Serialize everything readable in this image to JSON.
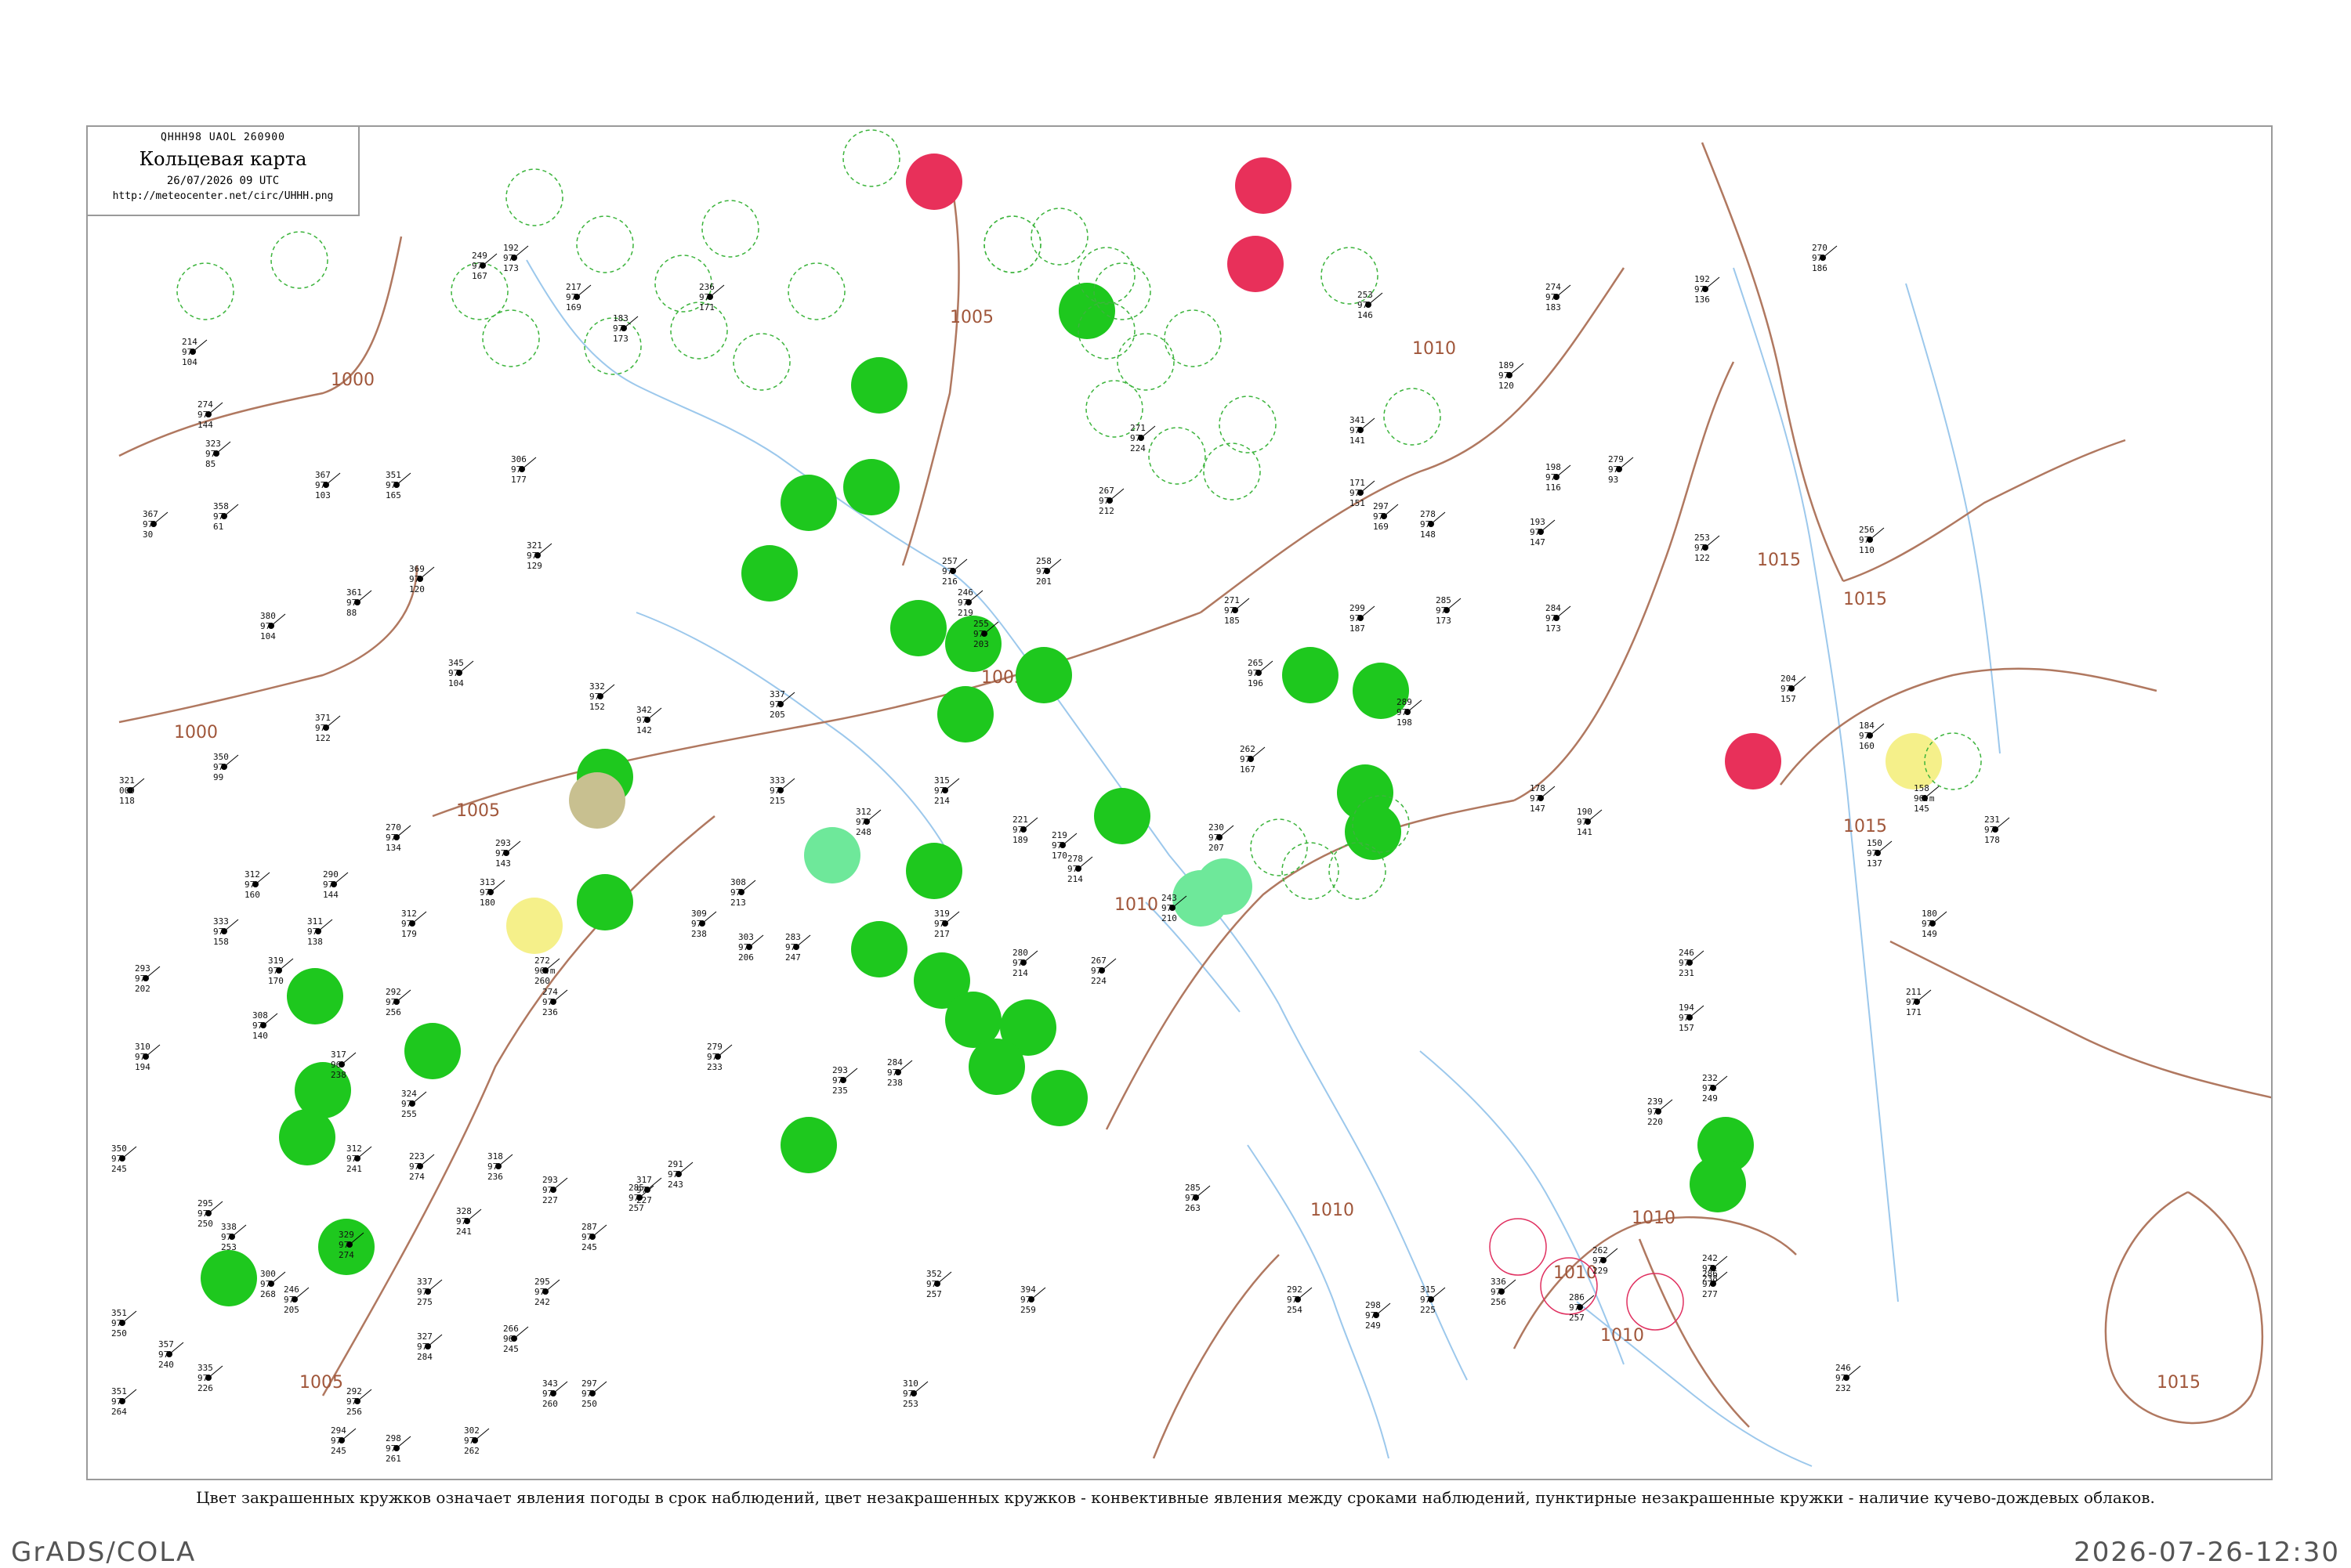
{
  "header": {
    "code": "QHHH98  UAOL  260900",
    "title": "Кольцевая карта",
    "datetime": "26/07/2026 09 UTC",
    "url": "http://meteocenter.net/circ/UHHH.png"
  },
  "isobars": [
    {
      "label": "1000"
    },
    {
      "label": "1000"
    },
    {
      "label": "1005"
    },
    {
      "label": "1005"
    },
    {
      "label": "1005"
    },
    {
      "label": "1005"
    },
    {
      "label": "1010"
    },
    {
      "label": "1010"
    },
    {
      "label": "1010"
    },
    {
      "label": "1010"
    },
    {
      "label": "1010"
    },
    {
      "label": "1015"
    },
    {
      "label": "1015"
    },
    {
      "label": "1015"
    },
    {
      "label": "1015"
    },
    {
      "label": "1010"
    }
  ],
  "circle_colors": {
    "rain": "#1ec81e",
    "shower": "#6ee89a",
    "thunder": "#e8305a",
    "fog": "#f5f08a",
    "dust": "#c8c090"
  },
  "stations": [
    {
      "t": "292",
      "p": "97",
      "d": "104"
    },
    {
      "t": "214",
      "p": "97",
      "d": "104"
    },
    {
      "t": "274",
      "p": "97",
      "d": "144"
    },
    {
      "t": "323",
      "p": "97",
      "d": "85"
    },
    {
      "t": "367",
      "p": "97",
      "d": "30"
    },
    {
      "t": "358",
      "p": "97",
      "d": "61"
    },
    {
      "t": "380",
      "p": "97",
      "d": "104"
    },
    {
      "t": "367",
      "p": "97",
      "d": "103"
    },
    {
      "t": "351",
      "p": "97",
      "d": "165"
    },
    {
      "t": "369",
      "p": "97",
      "d": "120"
    },
    {
      "t": "361",
      "p": "97",
      "d": "88"
    },
    {
      "t": "306",
      "p": "97",
      "d": "177"
    },
    {
      "t": "321",
      "p": "97",
      "d": "129"
    },
    {
      "t": "345",
      "p": "97",
      "d": "104"
    },
    {
      "t": "371",
      "p": "97",
      "d": "122"
    },
    {
      "t": "350",
      "p": "97",
      "d": "99"
    },
    {
      "t": "321",
      "p": "000",
      "d": "118"
    },
    {
      "t": "270",
      "p": "97",
      "d": "134"
    },
    {
      "t": "312",
      "p": "97",
      "d": "160"
    },
    {
      "t": "290",
      "p": "97",
      "d": "144"
    },
    {
      "t": "333",
      "p": "97",
      "d": "158"
    },
    {
      "t": "311",
      "p": "97",
      "d": "138"
    },
    {
      "t": "312",
      "p": "97",
      "d": "179"
    },
    {
      "t": "293",
      "p": "97",
      "d": "202"
    },
    {
      "t": "319",
      "p": "97",
      "d": "170"
    },
    {
      "t": "310",
      "p": "97",
      "d": "194"
    },
    {
      "t": "308",
      "p": "97",
      "d": "140"
    },
    {
      "t": "317",
      "p": "96",
      "d": "238"
    },
    {
      "t": "292",
      "p": "97",
      "d": "256"
    },
    {
      "t": "313",
      "p": "97",
      "d": "180"
    },
    {
      "t": "293",
      "p": "97",
      "d": "143"
    },
    {
      "t": "332",
      "p": "97",
      "d": "152"
    },
    {
      "t": "342",
      "p": "97",
      "d": "142"
    },
    {
      "t": "337",
      "p": "97",
      "d": "205"
    },
    {
      "t": "333",
      "p": "97",
      "d": "215"
    },
    {
      "t": "312",
      "p": "97",
      "d": "248"
    },
    {
      "t": "315",
      "p": "97",
      "d": "214"
    },
    {
      "t": "308",
      "p": "97",
      "d": "213"
    },
    {
      "t": "309",
      "p": "97",
      "d": "238"
    },
    {
      "t": "303",
      "p": "97",
      "d": "206"
    },
    {
      "t": "283",
      "p": "97",
      "d": "247"
    },
    {
      "t": "319",
      "p": "97",
      "d": "217"
    },
    {
      "t": "280",
      "p": "97",
      "d": "214"
    },
    {
      "t": "267",
      "p": "97",
      "d": "224"
    },
    {
      "t": "272",
      "p": "96.m",
      "d": "260"
    },
    {
      "t": "274",
      "p": "97",
      "d": "236"
    },
    {
      "t": "279",
      "p": "97",
      "d": "233"
    },
    {
      "t": "293",
      "p": "97",
      "d": "235"
    },
    {
      "t": "284",
      "p": "97",
      "d": "238"
    },
    {
      "t": "324",
      "p": "97",
      "d": "255"
    },
    {
      "t": "312",
      "p": "97",
      "d": "241"
    },
    {
      "t": "350",
      "p": "97",
      "d": "245"
    },
    {
      "t": "295",
      "p": "97",
      "d": "250"
    },
    {
      "t": "338",
      "p": "97",
      "d": "253"
    },
    {
      "t": "329",
      "p": "97",
      "d": "274"
    },
    {
      "t": "300",
      "p": "97",
      "d": "268"
    },
    {
      "t": "292",
      "p": "97",
      "d": "256"
    },
    {
      "t": "223",
      "p": "97",
      "d": "274"
    },
    {
      "t": "328",
      "p": "97",
      "d": "241"
    },
    {
      "t": "318",
      "p": "97",
      "d": "236"
    },
    {
      "t": "293",
      "p": "97",
      "d": "227"
    },
    {
      "t": "317",
      "p": "97",
      "d": "227"
    },
    {
      "t": "291",
      "p": "97",
      "d": "243"
    },
    {
      "t": "285",
      "p": "97",
      "d": "257"
    },
    {
      "t": "287",
      "p": "97",
      "d": "245"
    },
    {
      "t": "295",
      "p": "97",
      "d": "242"
    },
    {
      "t": "337",
      "p": "97",
      "d": "275"
    },
    {
      "t": "246",
      "p": "97",
      "d": "205"
    },
    {
      "t": "351",
      "p": "97",
      "d": "250"
    },
    {
      "t": "357",
      "p": "97",
      "d": "240"
    },
    {
      "t": "335",
      "p": "97",
      "d": "226"
    },
    {
      "t": "351",
      "p": "97",
      "d": "264"
    },
    {
      "t": "294",
      "p": "97",
      "d": "245"
    },
    {
      "t": "298",
      "p": "97",
      "d": "261"
    },
    {
      "t": "302",
      "p": "97",
      "d": "262"
    },
    {
      "t": "327",
      "p": "97",
      "d": "284"
    },
    {
      "t": "266",
      "p": "96",
      "d": "245"
    },
    {
      "t": "343",
      "p": "97",
      "d": "260"
    },
    {
      "t": "297",
      "p": "97",
      "d": "250"
    },
    {
      "t": "352",
      "p": "97",
      "d": "257"
    },
    {
      "t": "310",
      "p": "97",
      "d": "253"
    },
    {
      "t": "394",
      "p": "97",
      "d": "259"
    },
    {
      "t": "285",
      "p": "97",
      "d": "263"
    },
    {
      "t": "292",
      "p": "97",
      "d": "254"
    },
    {
      "t": "298",
      "p": "97",
      "d": "249"
    },
    {
      "t": "315",
      "p": "97",
      "d": "225"
    },
    {
      "t": "336",
      "p": "97",
      "d": "256"
    },
    {
      "t": "286",
      "p": "97",
      "d": "257"
    },
    {
      "t": "262",
      "p": "97",
      "d": "229"
    },
    {
      "t": "242",
      "p": "97",
      "d": "238"
    },
    {
      "t": "246",
      "p": "97",
      "d": "232"
    },
    {
      "t": "286",
      "p": "97",
      "d": "277"
    },
    {
      "t": "232",
      "p": "97",
      "d": "249"
    },
    {
      "t": "239",
      "p": "97",
      "d": "220"
    },
    {
      "t": "246",
      "p": "97",
      "d": "231"
    },
    {
      "t": "194",
      "p": "97",
      "d": "157"
    },
    {
      "t": "211",
      "p": "97",
      "d": "171"
    },
    {
      "t": "180",
      "p": "97",
      "d": "149"
    },
    {
      "t": "231",
      "p": "97",
      "d": "178"
    },
    {
      "t": "158",
      "p": "96.m",
      "d": "145"
    },
    {
      "t": "150",
      "p": "97",
      "d": "137"
    },
    {
      "t": "184",
      "p": "97",
      "d": "160"
    },
    {
      "t": "178",
      "p": "97",
      "d": "147"
    },
    {
      "t": "190",
      "p": "97",
      "d": "141"
    },
    {
      "t": "192",
      "p": "97",
      "d": "136"
    },
    {
      "t": "253",
      "p": "97",
      "d": "122"
    },
    {
      "t": "256",
      "p": "97",
      "d": "110"
    },
    {
      "t": "204",
      "p": "97",
      "d": "157"
    },
    {
      "t": "189",
      "p": "97",
      "d": "120"
    },
    {
      "t": "198",
      "p": "97",
      "d": "116"
    },
    {
      "t": "193",
      "p": "97",
      "d": "147"
    },
    {
      "t": "278",
      "p": "97",
      "d": "148"
    },
    {
      "t": "285",
      "p": "97",
      "d": "173"
    },
    {
      "t": "284",
      "p": "97",
      "d": "173"
    },
    {
      "t": "289",
      "p": "97",
      "d": "198"
    },
    {
      "t": "279",
      "p": "97",
      "d": "93"
    },
    {
      "t": "274",
      "p": "97",
      "d": "183"
    },
    {
      "t": "270",
      "p": "97",
      "d": "186"
    },
    {
      "t": "253",
      "p": "97",
      "d": "146"
    },
    {
      "t": "341",
      "p": "97",
      "d": "141"
    },
    {
      "t": "171",
      "p": "97",
      "d": "151"
    },
    {
      "t": "297",
      "p": "97",
      "d": "169"
    },
    {
      "t": "299",
      "p": "97",
      "d": "187"
    },
    {
      "t": "271",
      "p": "97",
      "d": "185"
    },
    {
      "t": "265",
      "p": "97",
      "d": "196"
    },
    {
      "t": "262",
      "p": "97",
      "d": "167"
    },
    {
      "t": "230",
      "p": "97",
      "d": "207"
    },
    {
      "t": "243",
      "p": "97",
      "d": "210"
    },
    {
      "t": "278",
      "p": "97",
      "d": "214"
    },
    {
      "t": "219",
      "p": "97",
      "d": "170"
    },
    {
      "t": "221",
      "p": "97",
      "d": "189"
    },
    {
      "t": "246",
      "p": "97",
      "d": "219"
    },
    {
      "t": "257",
      "p": "97",
      "d": "216"
    },
    {
      "t": "255",
      "p": "97",
      "d": "203"
    },
    {
      "t": "258",
      "p": "97",
      "d": "201"
    },
    {
      "t": "267",
      "p": "97",
      "d": "212"
    },
    {
      "t": "271",
      "p": "97",
      "d": "224"
    },
    {
      "t": "249",
      "p": "97",
      "d": "167"
    },
    {
      "t": "217",
      "p": "97",
      "d": "169"
    },
    {
      "t": "192",
      "p": "97",
      "d": "173"
    },
    {
      "t": "183",
      "p": "97",
      "d": "173"
    },
    {
      "t": "236",
      "p": "97",
      "d": "171"
    }
  ],
  "caption": "Цвет закрашенных кружков означает явления погоды в срок наблюдений, цвет незакрашенных кружков - конвективные явления между сроками наблюдений, пунктирные незакрашенные кружки - наличие кучево-дождевых облаков.",
  "footer": {
    "left": "GrADS/COLA",
    "right": "2026-07-26-12:30"
  }
}
